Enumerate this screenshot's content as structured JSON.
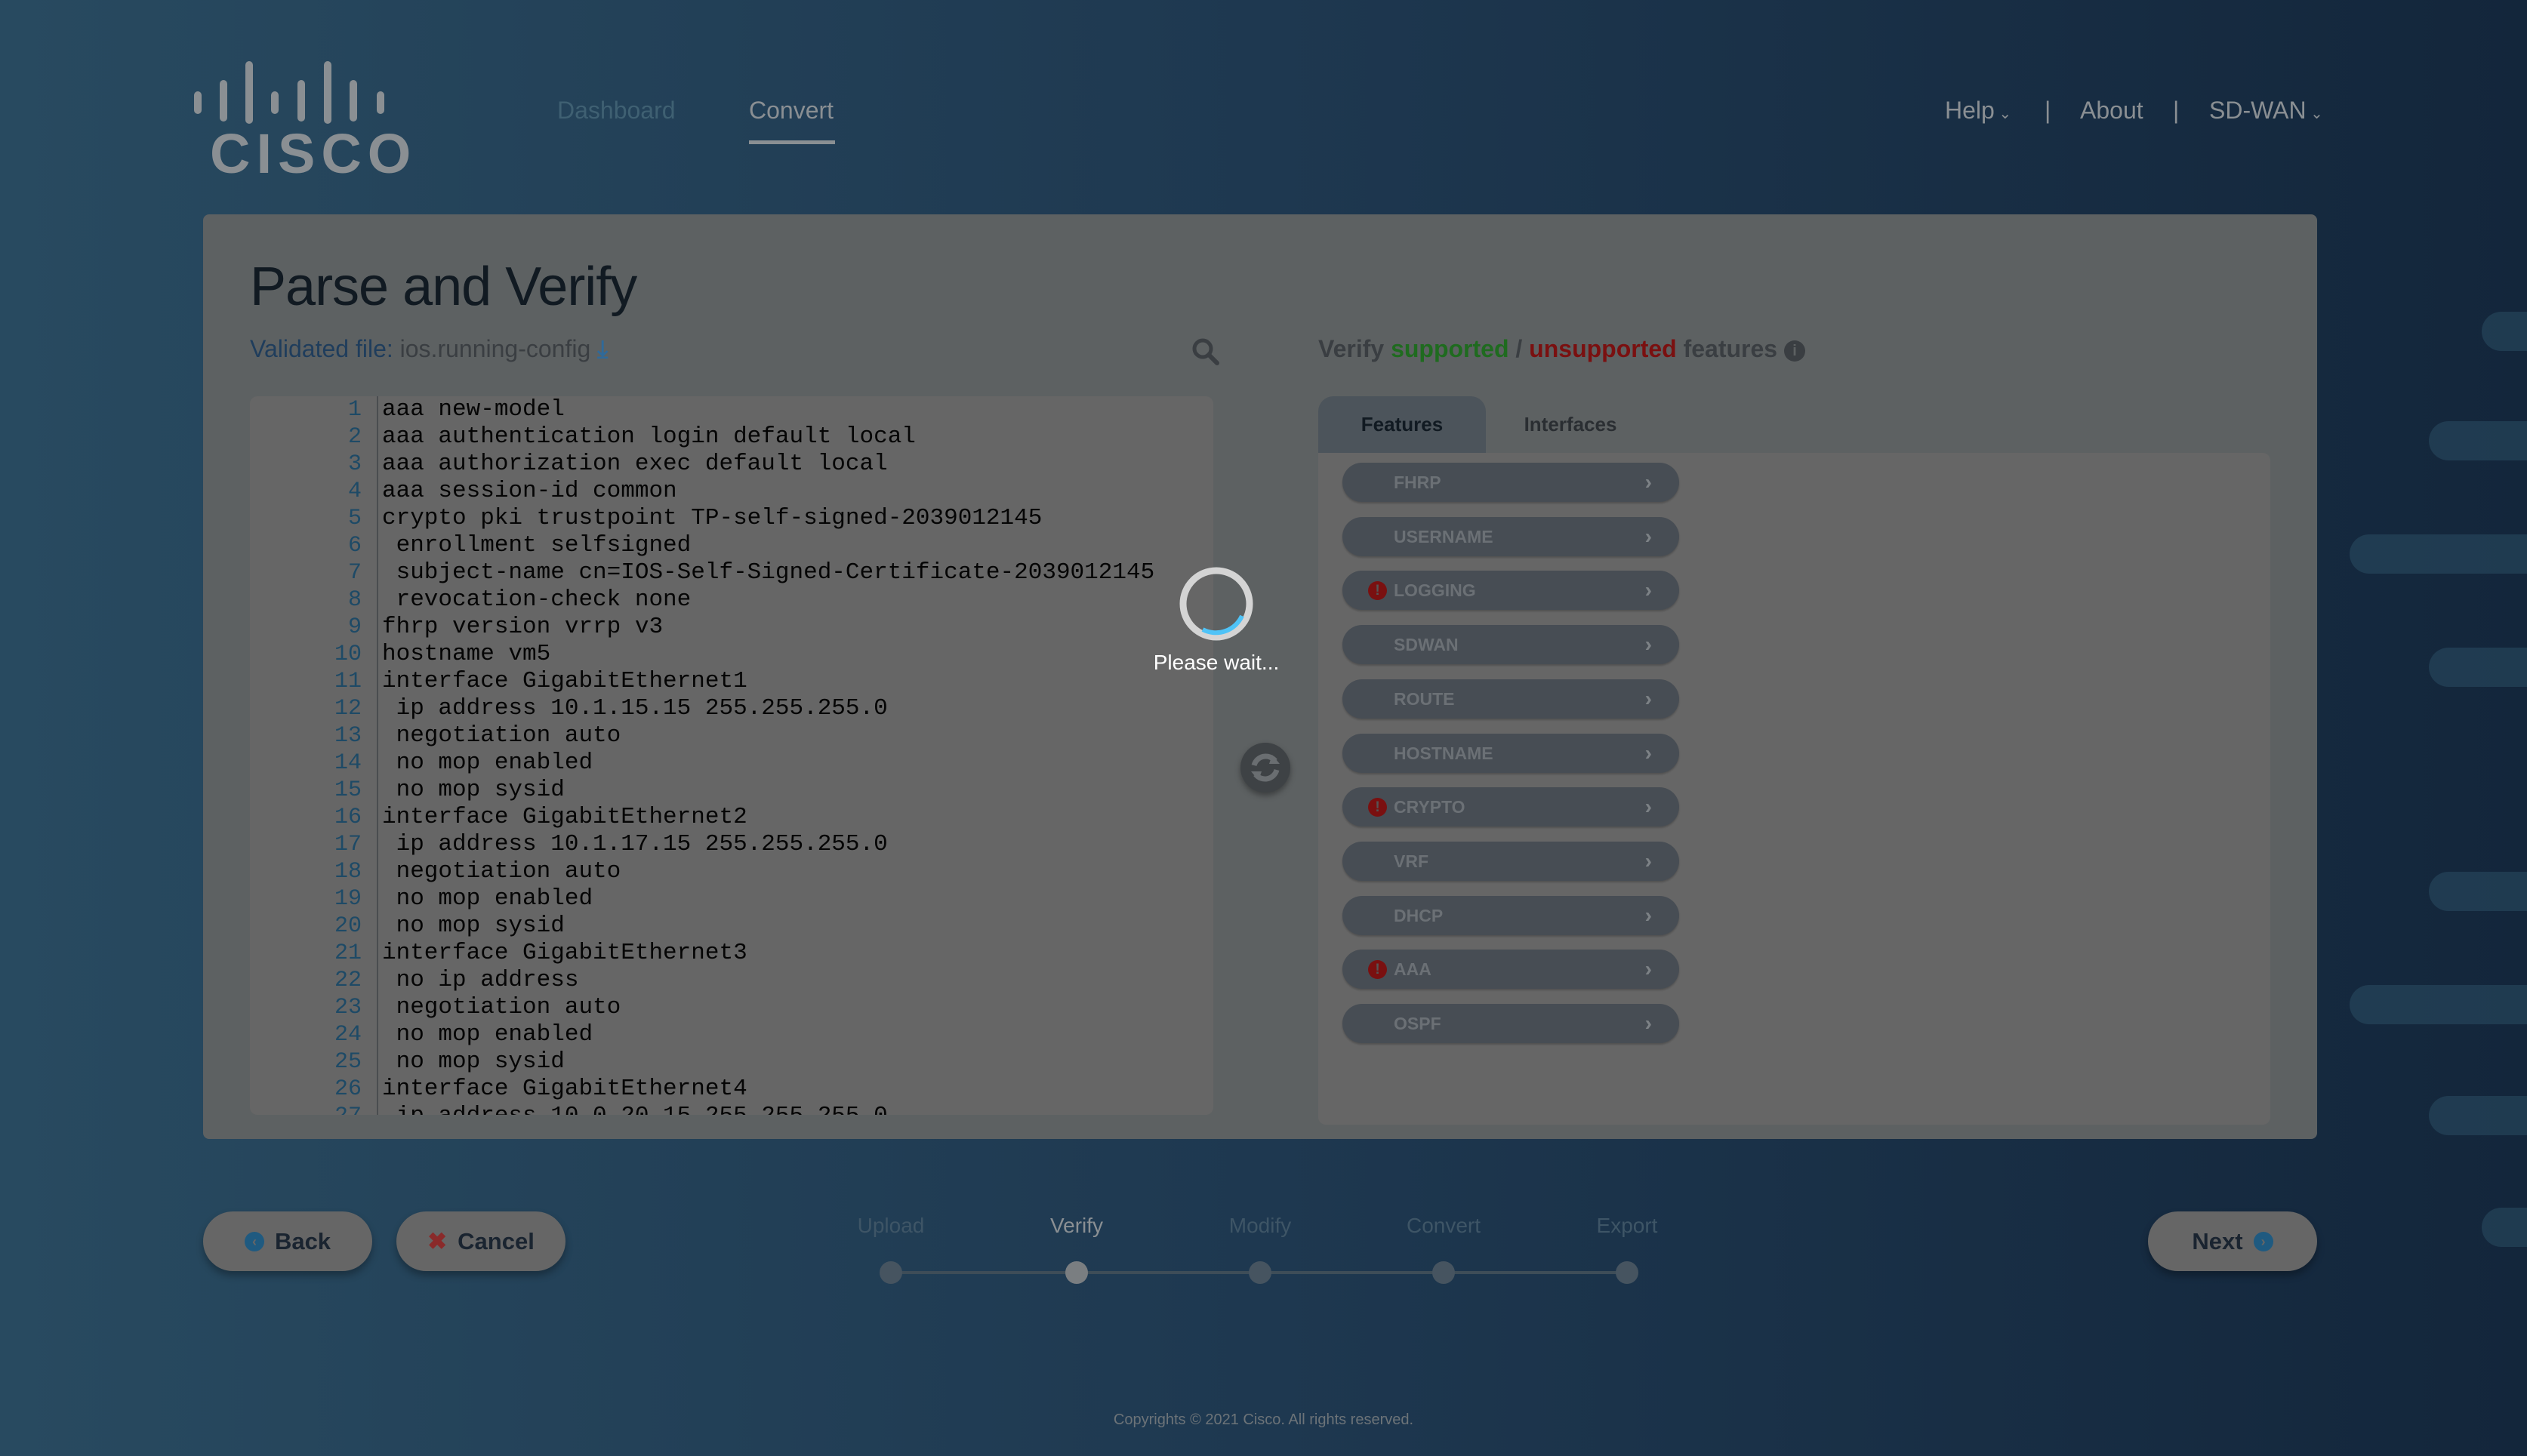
{
  "header": {
    "logo_text": "cisco",
    "nav": [
      {
        "label": "Dashboard",
        "active": false
      },
      {
        "label": "Convert",
        "active": true
      }
    ],
    "right_menu": [
      {
        "label": "Help",
        "dropdown": true
      },
      {
        "label": "About",
        "dropdown": false
      },
      {
        "label": "SD-WAN",
        "dropdown": true
      }
    ],
    "separator": "|"
  },
  "page": {
    "title": "Parse and Verify",
    "validated_label": "Validated file:",
    "file_name": "ios.running-config"
  },
  "code_lines": [
    "aaa new-model",
    "aaa authentication login default local",
    "aaa authorization exec default local",
    "aaa session-id common",
    "crypto pki trustpoint TP-self-signed-2039012145",
    " enrollment selfsigned",
    " subject-name cn=IOS-Self-Signed-Certificate-2039012145",
    " revocation-check none",
    "fhrp version vrrp v3",
    "hostname vm5",
    "interface GigabitEthernet1",
    " ip address 10.1.15.15 255.255.255.0",
    " negotiation auto",
    " no mop enabled",
    " no mop sysid",
    "interface GigabitEthernet2",
    " ip address 10.1.17.15 255.255.255.0",
    " negotiation auto",
    " no mop enabled",
    " no mop sysid",
    "interface GigabitEthernet3",
    " no ip address",
    " negotiation auto",
    " no mop enabled",
    " no mop sysid",
    "interface GigabitEthernet4",
    " ip address 10.0.20.15 255.255.255.0"
  ],
  "verify": {
    "prefix": "Verify",
    "supported": "supported",
    "slash": "/",
    "unsupported": "unsupported",
    "suffix": "features",
    "supported_color": "#1f6b1f",
    "unsupported_color": "#7a1010"
  },
  "tabs": [
    {
      "label": "Features",
      "active": true
    },
    {
      "label": "Interfaces",
      "active": false
    }
  ],
  "features": [
    {
      "name": "FHRP",
      "unsupported": false
    },
    {
      "name": "USERNAME",
      "unsupported": false
    },
    {
      "name": "LOGGING",
      "unsupported": true
    },
    {
      "name": "SDWAN",
      "unsupported": false
    },
    {
      "name": "ROUTE",
      "unsupported": false
    },
    {
      "name": "HOSTNAME",
      "unsupported": false
    },
    {
      "name": "CRYPTO",
      "unsupported": true
    },
    {
      "name": "VRF",
      "unsupported": false
    },
    {
      "name": "DHCP",
      "unsupported": false
    },
    {
      "name": "AAA",
      "unsupported": true
    },
    {
      "name": "OSPF",
      "unsupported": false
    }
  ],
  "loading": {
    "text": "Please wait...",
    "spinner_color": "#4fc3f7"
  },
  "footer_nav": {
    "back": "Back",
    "cancel": "Cancel",
    "next": "Next",
    "steps": [
      "Upload",
      "Verify",
      "Modify",
      "Convert",
      "Export"
    ],
    "current_step": "Verify"
  },
  "copyright": "Copyrights © 2021 Cisco. All rights reserved."
}
